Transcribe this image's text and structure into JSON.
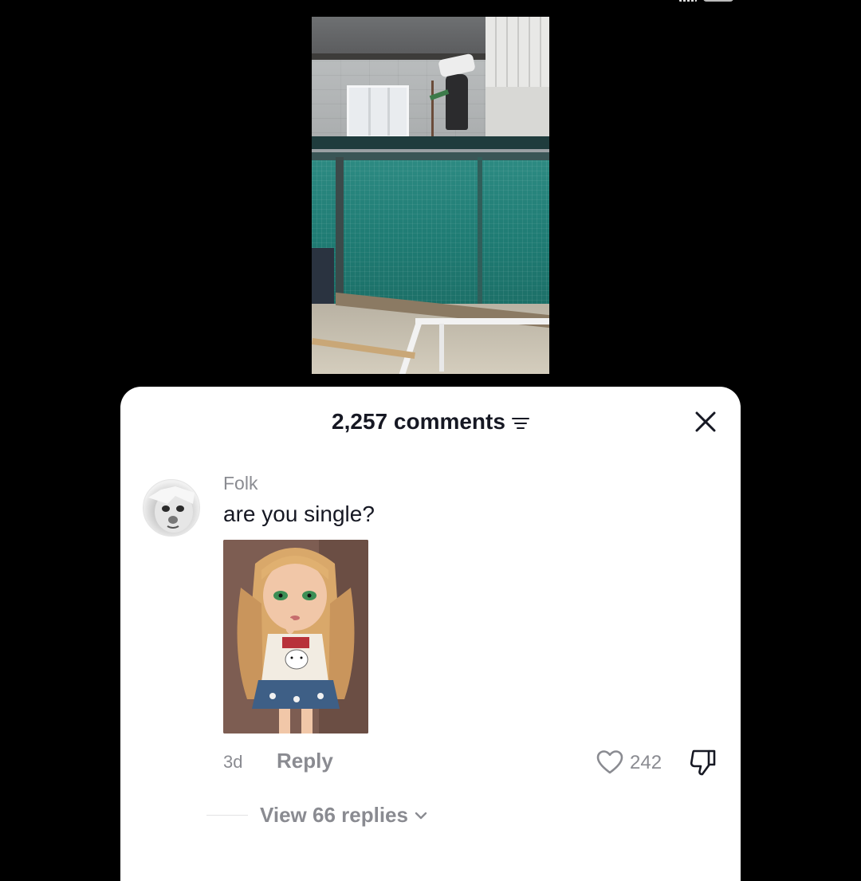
{
  "comments_panel": {
    "count_label": "2,257 comments"
  },
  "comment": {
    "username": "Folk",
    "text": "are you single?",
    "time": "3d",
    "reply_label": "Reply",
    "likes": "242",
    "view_replies_label": "View 66 replies"
  },
  "icons": {
    "sort": "sort-icon",
    "close": "close-icon",
    "like": "heart-outline-icon",
    "dislike": "thumbs-down-icon",
    "expand": "chevron-down-icon"
  },
  "colors": {
    "background": "#000000",
    "sheet": "#ffffff",
    "primary_text": "#161823",
    "secondary_text": "#8a8b91"
  }
}
